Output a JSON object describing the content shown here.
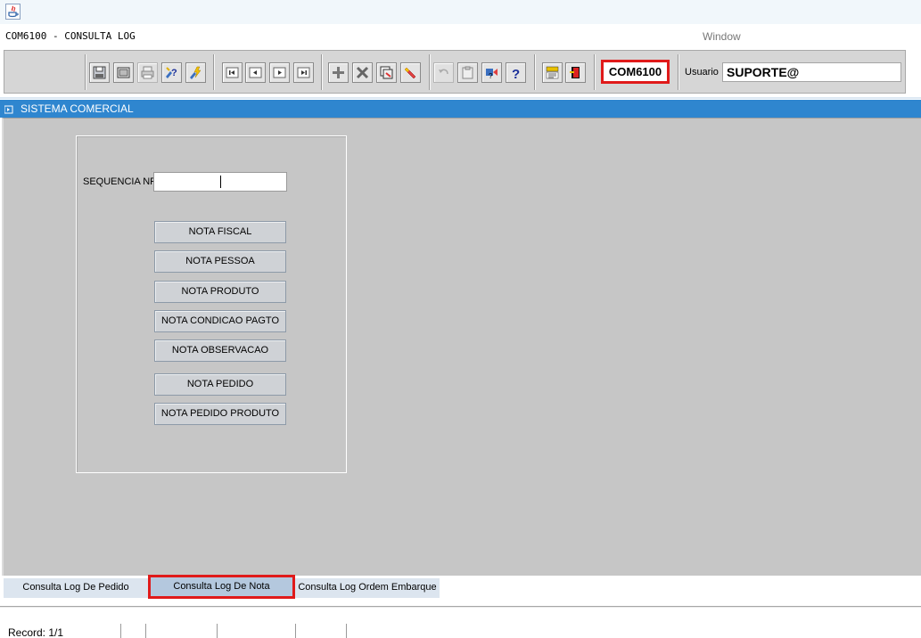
{
  "window": {
    "form_title": "COM6100 - CONSULTA LOG",
    "menu_window": "Window"
  },
  "toolbar": {
    "form_code": "COM6100",
    "user_label": "Usuario",
    "user_value": "SUPORTE@"
  },
  "system": {
    "title": "SISTEMA COMERCIAL"
  },
  "form": {
    "seq_label": "SEQUENCIA NF",
    "seq_value": "",
    "buttons": [
      "NOTA FISCAL",
      "NOTA PESSOA",
      "NOTA PRODUTO",
      "NOTA CONDICAO PAGTO",
      "NOTA OBSERVACAO",
      "NOTA PEDIDO",
      "NOTA PEDIDO PRODUTO"
    ]
  },
  "tabs": [
    {
      "label": "Consulta Log De Pedido"
    },
    {
      "label": "Consulta Log De Nota"
    },
    {
      "label": "Consulta Log Ordem Embarque"
    }
  ],
  "status": {
    "record": "Record: 1/1"
  },
  "colors": {
    "accent": "#2f86cf",
    "highlight": "#e01a1a"
  }
}
